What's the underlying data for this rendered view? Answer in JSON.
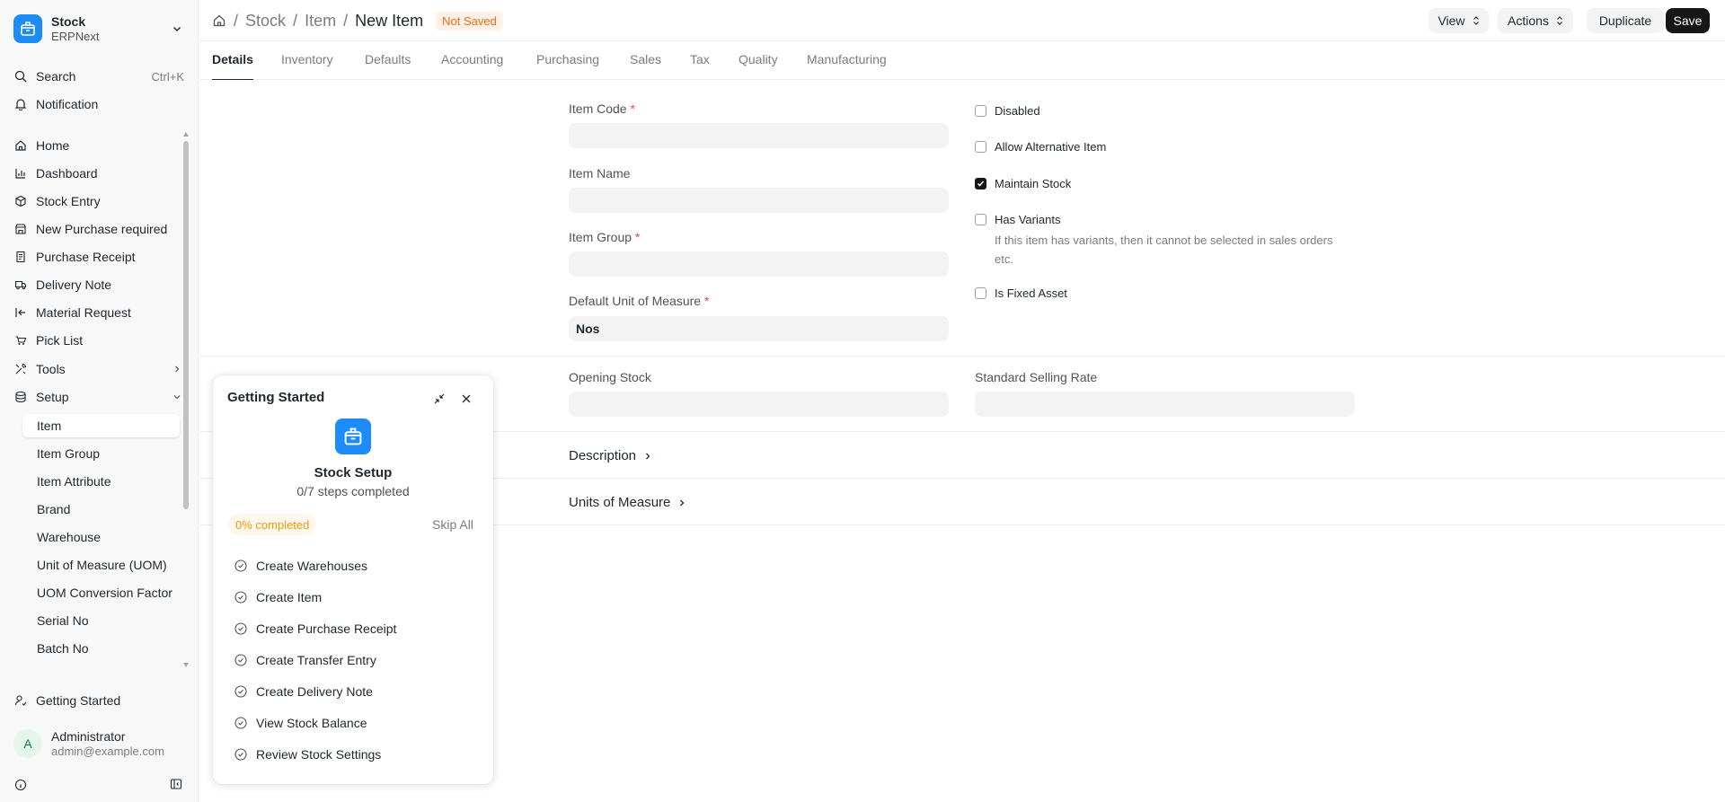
{
  "app": {
    "name": "Stock",
    "subtitle": "ERPNext"
  },
  "sidebar": {
    "search": {
      "label": "Search",
      "shortcut": "Ctrl+K"
    },
    "notification": "Notification",
    "items": [
      {
        "label": "Home",
        "icon": "home-icon"
      },
      {
        "label": "Dashboard",
        "icon": "chart-icon"
      },
      {
        "label": "Stock Entry",
        "icon": "box-icon"
      },
      {
        "label": "New Purchase required",
        "icon": "store-icon"
      },
      {
        "label": "Purchase Receipt",
        "icon": "receipt-icon"
      },
      {
        "label": "Delivery Note",
        "icon": "truck-icon"
      },
      {
        "label": "Material Request",
        "icon": "arrow-in-icon"
      },
      {
        "label": "Pick List",
        "icon": "cart-icon"
      },
      {
        "label": "Tools",
        "icon": "tools-icon"
      },
      {
        "label": "Setup",
        "icon": "database-icon"
      }
    ],
    "setup_children": [
      "Item",
      "Item Group",
      "Item Attribute",
      "Brand",
      "Warehouse",
      "Unit of Measure (UOM)",
      "UOM Conversion Factor",
      "Serial No",
      "Batch No"
    ],
    "getting_started": "Getting Started",
    "user": {
      "initial": "A",
      "name": "Administrator",
      "email": "admin@example.com"
    }
  },
  "header": {
    "breadcrumbs": [
      "Stock",
      "Item"
    ],
    "title": "New Item",
    "status": "Not Saved",
    "view_label": "View",
    "actions_label": "Actions",
    "duplicate_label": "Duplicate",
    "save_label": "Save"
  },
  "tabs": [
    "Details",
    "Inventory",
    "Defaults",
    "Accounting",
    "Purchasing",
    "Sales",
    "Tax",
    "Quality",
    "Manufacturing"
  ],
  "form": {
    "item_code": {
      "label": "Item Code",
      "value": ""
    },
    "item_name": {
      "label": "Item Name",
      "value": ""
    },
    "item_group": {
      "label": "Item Group",
      "value": ""
    },
    "uom": {
      "label": "Default Unit of Measure",
      "value": "Nos"
    },
    "required_mark": "*",
    "checks": {
      "disabled": {
        "label": "Disabled",
        "checked": false
      },
      "allow_alt": {
        "label": "Allow Alternative Item",
        "checked": false
      },
      "maintain_stock": {
        "label": "Maintain Stock",
        "checked": true
      },
      "has_variants": {
        "label": "Has Variants",
        "checked": false,
        "help": "If this item has variants, then it cannot be selected in sales orders etc."
      },
      "fixed_asset": {
        "label": "Is Fixed Asset",
        "checked": false
      }
    },
    "opening_stock": {
      "label": "Opening Stock",
      "value": ""
    },
    "selling_rate": {
      "label": "Standard Selling Rate",
      "value": ""
    },
    "description_section": "Description",
    "uom_section": "Units of Measure"
  },
  "getting_started": {
    "title": "Getting Started",
    "module": "Stock Setup",
    "steps_text": "0/7 steps completed",
    "progress_label": "0% completed",
    "progress": 0,
    "skip_label": "Skip All",
    "steps": [
      "Create Warehouses",
      "Create Item",
      "Create Purchase Receipt",
      "Create Transfer Entry",
      "Create Delivery Note",
      "View Stock Balance",
      "Review Stock Settings"
    ]
  },
  "colors": {
    "brand": "#1d8cf8",
    "primary_button": "#171717",
    "status": "#e86c13"
  }
}
